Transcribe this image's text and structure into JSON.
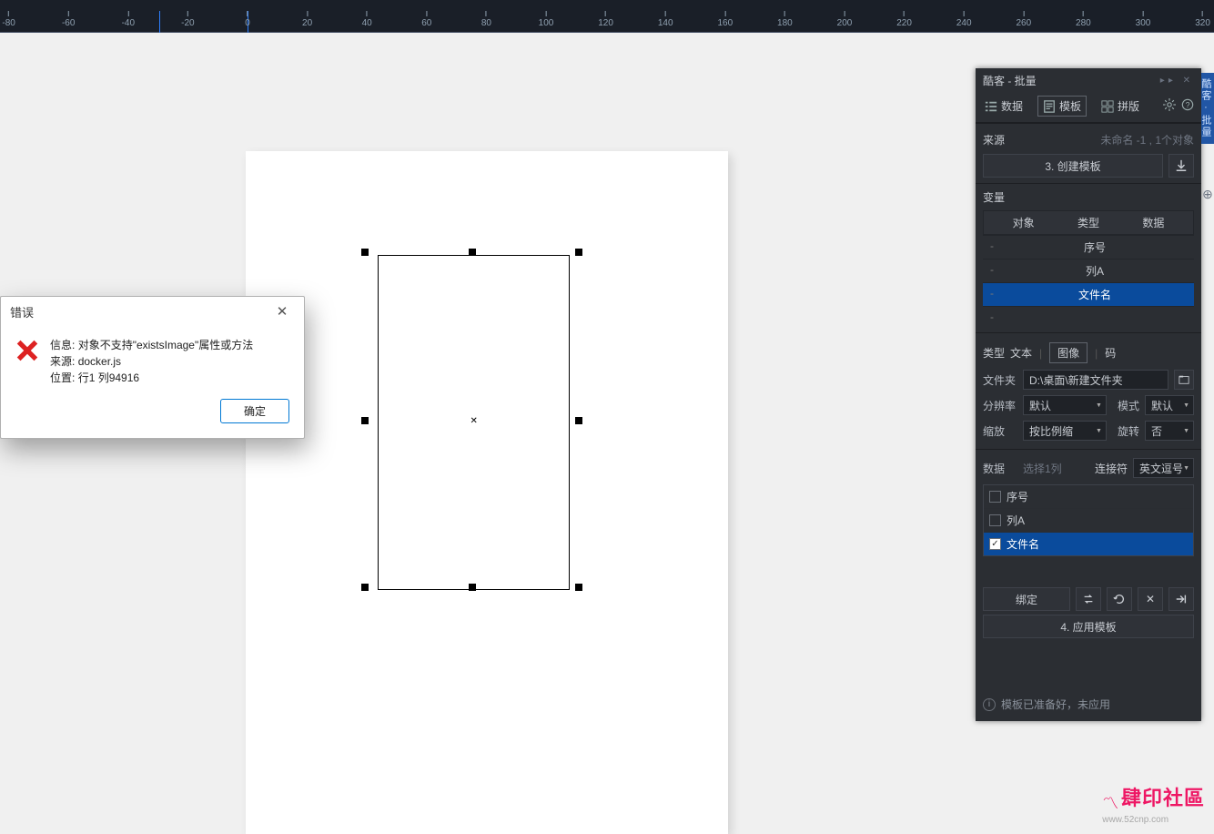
{
  "ruler": {
    "start": -100,
    "end": 400,
    "step": 20
  },
  "dialog": {
    "title": "错误",
    "info_label": "信息:",
    "info_text": "对象不支持\"existsImage\"属性或方法",
    "source_label": "来源:",
    "source_text": "docker.js",
    "pos_label": "位置:",
    "pos_text": "行1 列94916",
    "ok": "确定"
  },
  "panel": {
    "title": "酷客 - 批量",
    "tabs": {
      "data": "数据",
      "template": "模板",
      "layout": "拼版"
    },
    "source": {
      "label": "来源",
      "value": "未命名 -1 , 1个对象"
    },
    "create_template": "3. 创建模板",
    "variable": {
      "label": "变量",
      "header": {
        "obj": "对象",
        "type": "类型",
        "data": "数据"
      },
      "rows": [
        "序号",
        "列A",
        "文件名"
      ]
    },
    "type_row": {
      "label": "类型",
      "text": "文本",
      "image": "图像",
      "code": "码"
    },
    "folder": {
      "label": "文件夹",
      "value": "D:\\桌面\\新建文件夹"
    },
    "resolution": {
      "label": "分辨率",
      "value": "默认",
      "mode_label": "模式",
      "mode_value": "默认"
    },
    "scale": {
      "label": "缩放",
      "value": "按比例缩",
      "rotate_label": "旋转",
      "rotate_value": "否"
    },
    "data_section": {
      "label": "数据",
      "placeholder": "选择1列",
      "join_label": "连接符",
      "join_value": "英文逗号"
    },
    "checks": [
      {
        "label": "序号",
        "checked": false
      },
      {
        "label": "列A",
        "checked": false
      },
      {
        "label": "文件名",
        "checked": true
      }
    ],
    "bind": "绑定",
    "apply_template": "4. 应用模板",
    "status": "模板已准备好，未应用"
  },
  "side_tab": "酷客·批量",
  "watermark": {
    "brand": "肆印社區",
    "url": "www.52cnp.com"
  }
}
